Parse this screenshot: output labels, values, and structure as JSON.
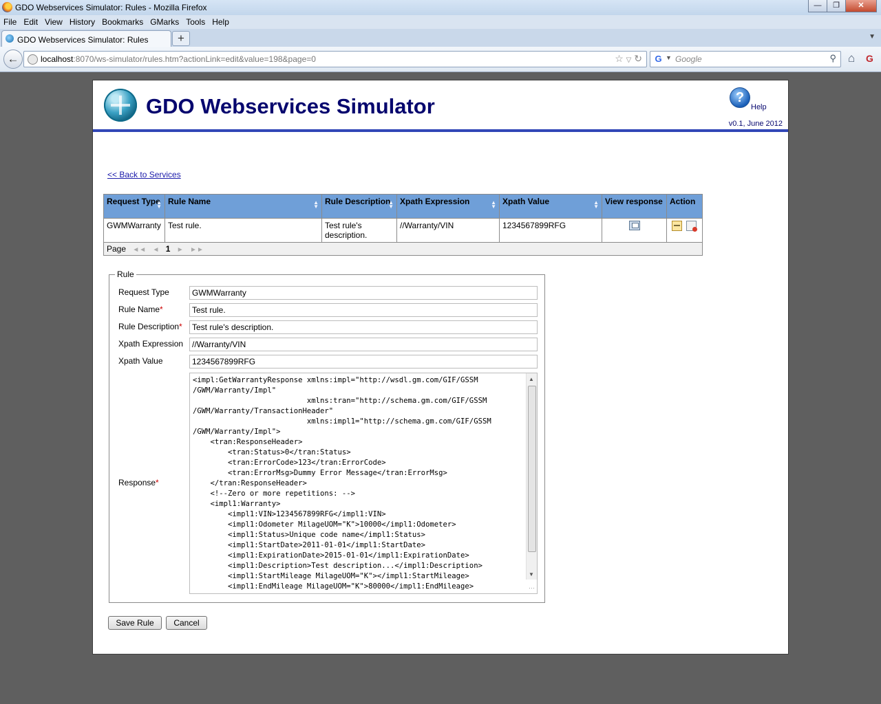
{
  "window": {
    "title": "GDO Webservices Simulator: Rules - Mozilla Firefox"
  },
  "menu": [
    "File",
    "Edit",
    "View",
    "History",
    "Bookmarks",
    "GMarks",
    "Tools",
    "Help"
  ],
  "tab": {
    "label": "GDO Webservices Simulator: Rules",
    "new_tab": "+"
  },
  "urlbar": {
    "host": "localhost",
    "rest": ":8070/ws-simulator/rules.htm?actionLink=edit&value=198&page=0"
  },
  "search": {
    "placeholder": "Google",
    "engine": "G"
  },
  "header": {
    "title": "GDO Webservices Simulator",
    "help_label": "Help",
    "version": "v0.1, June 2012"
  },
  "back_link": "<< Back to Services",
  "table": {
    "columns": [
      "Request Type",
      "Rule Name",
      "Rule Description",
      "Xpath Expression",
      "Xpath Value",
      "View response",
      "Action"
    ],
    "rows": [
      {
        "request_type": "GWMWarranty",
        "rule_name": "Test rule.",
        "rule_description": "Test rule's description.",
        "xpath_expression": "//Warranty/VIN",
        "xpath_value": "1234567899RFG"
      }
    ],
    "pager": {
      "label": "Page",
      "current": "1"
    }
  },
  "form": {
    "legend": "Rule",
    "fields": {
      "request_type": {
        "label": "Request Type",
        "value": "GWMWarranty"
      },
      "rule_name": {
        "label": "Rule Name",
        "value": "Test rule."
      },
      "rule_description": {
        "label": "Rule Description",
        "value": "Test rule's description."
      },
      "xpath_expression": {
        "label": "Xpath Expression",
        "value": "//Warranty/VIN"
      },
      "xpath_value": {
        "label": "Xpath Value",
        "value": "1234567899RFG"
      },
      "response": {
        "label": "Response",
        "value": "<impl:GetWarrantyResponse xmlns:impl=\"http://wsdl.gm.com/GIF/GSSM\n/GWM/Warranty/Impl\"\n                          xmlns:tran=\"http://schema.gm.com/GIF/GSSM\n/GWM/Warranty/TransactionHeader\"\n                          xmlns:impl1=\"http://schema.gm.com/GIF/GSSM\n/GWM/Warranty/Impl\">\n    <tran:ResponseHeader>\n        <tran:Status>0</tran:Status>\n        <tran:ErrorCode>123</tran:ErrorCode>\n        <tran:ErrorMsg>Dummy Error Message</tran:ErrorMsg>\n    </tran:ResponseHeader>\n    <!--Zero or more repetitions: -->\n    <impl1:Warranty>\n        <impl1:VIN>1234567899RFG</impl1:VIN>\n        <impl1:Odometer MilageUOM=\"K\">10000</impl1:Odometer>\n        <impl1:Status>Unique code name</impl1:Status>\n        <impl1:StartDate>2011-01-01</impl1:StartDate>\n        <impl1:ExpirationDate>2015-01-01</impl1:ExpirationDate>\n        <impl1:Description>Test description...</impl1:Description>\n        <impl1:StartMileage MilageUOM=\"K\"></impl1:StartMileage>\n        <impl1:EndMileage MilageUOM=\"K\">80000</impl1:EndMileage>"
      }
    },
    "required_mark": "*",
    "save_label": "Save Rule",
    "cancel_label": "Cancel"
  }
}
